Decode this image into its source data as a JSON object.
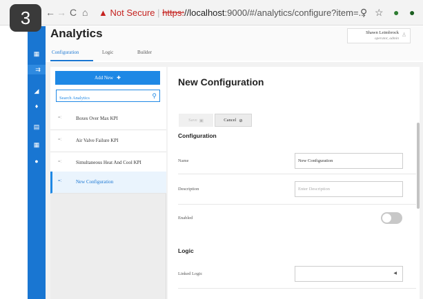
{
  "step_badge": "3",
  "browser": {
    "back": "←",
    "forward": "→",
    "reload": "C",
    "home": "⌂",
    "warning_icon": "▲",
    "security_label": "Not Secure",
    "separator": "|",
    "url_scheme": "https:",
    "url_host": "//localhost",
    "url_rest": ":9000/#/analytics/configure?item=...",
    "zoom_icon": "⚲",
    "star_icon": "☆",
    "ext1_icon": "●",
    "ext2_icon": "●"
  },
  "sidebar": {
    "icons": [
      {
        "name": "dashboard-icon",
        "glyph": "▦"
      },
      {
        "name": "analytics-icon",
        "glyph": "⇉"
      },
      {
        "name": "chart-icon",
        "glyph": "◢"
      },
      {
        "name": "alarm-icon",
        "glyph": "♦"
      },
      {
        "name": "clipboard-icon",
        "glyph": "▤"
      },
      {
        "name": "calendar-icon",
        "glyph": "▦"
      },
      {
        "name": "user-icon",
        "glyph": "●"
      }
    ]
  },
  "header": {
    "title": "Analytics",
    "tabs": [
      "Configuration",
      "Logic",
      "Builder"
    ],
    "user_name": "Shawn Leimbrock",
    "user_role": "operator, admin",
    "avatar_glyph": "♙"
  },
  "list": {
    "add_button": "Add New",
    "add_icon": "✚",
    "search_placeholder": "Search Analytics",
    "search_icon": "⚲",
    "item_icon": "=:",
    "items": [
      "Boxes Over Max KPI",
      "Air Valve Failure KPI",
      "Simultaneous Heat And Cool KPI",
      "New Configuration"
    ]
  },
  "form": {
    "title": "New Configuration",
    "save_label": "Save",
    "save_icon": "▣",
    "cancel_label": "Cancel",
    "cancel_icon": "⊘",
    "configuration_heading": "Configuration",
    "name_label": "Name",
    "name_value": "New Configuration",
    "description_label": "Description",
    "description_placeholder": "Enter Description",
    "enabled_label": "Enabled",
    "enabled": false,
    "logic_heading": "Logic",
    "linked_logic_label": "Linked Logic",
    "linked_logic_caret": "◀"
  },
  "colors": {
    "accent": "#1976d2",
    "sidebar": "#1976d2",
    "warning": "#c5221f"
  }
}
